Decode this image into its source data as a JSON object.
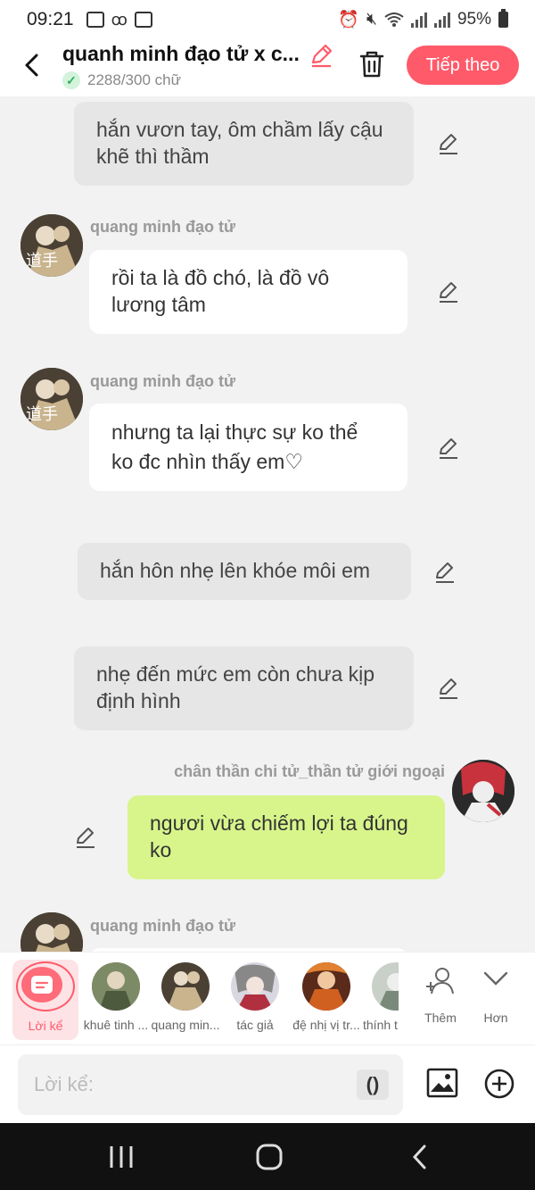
{
  "status_bar": {
    "time": "09:21",
    "battery": "95%"
  },
  "header": {
    "title": "quanh minh đạo tử x c...",
    "word_count": "2288/300 chữ",
    "next_button": "Tiếp theo"
  },
  "messages": [
    {
      "type": "narration",
      "text": "hắn vươn tay, ôm chầm lấy cậu khẽ thì thầm"
    },
    {
      "type": "character",
      "name": "quang minh đạo tử",
      "text": "rồi ta là đồ chó,  là đồ vô lương tâm"
    },
    {
      "type": "character",
      "name": "quang minh đạo tử",
      "text": "nhưng ta lại thực sự ko thể ko đc nhìn thấy em♡"
    },
    {
      "type": "narration",
      "text": "hắn hôn nhẹ lên khóe môi em"
    },
    {
      "type": "narration",
      "text": "nhẹ đến mức em còn chưa kịp định hình"
    },
    {
      "type": "self",
      "name": "chân thần chi tử_thần tử giới ngoại",
      "text": "ngươi vừa chiếm lợi ta đúng ko"
    },
    {
      "type": "character",
      "name": "quang minh đạo tử",
      "text": ""
    }
  ],
  "character_bar": {
    "selected_label": "Lời kể",
    "characters": [
      {
        "label": "khuê tinh ..."
      },
      {
        "label": "quang min..."
      },
      {
        "label": "tác giả"
      },
      {
        "label": "đệ nhị vị tr..."
      },
      {
        "label": "thính t"
      }
    ],
    "add_label": "Thêm",
    "more_label": "Hơn"
  },
  "input": {
    "placeholder": "Lời kể:",
    "paren_button": "()"
  },
  "colors": {
    "accent": "#ff5a6a",
    "self_bubble": "#d7f58b",
    "narration_bubble": "#e6e6e6"
  }
}
